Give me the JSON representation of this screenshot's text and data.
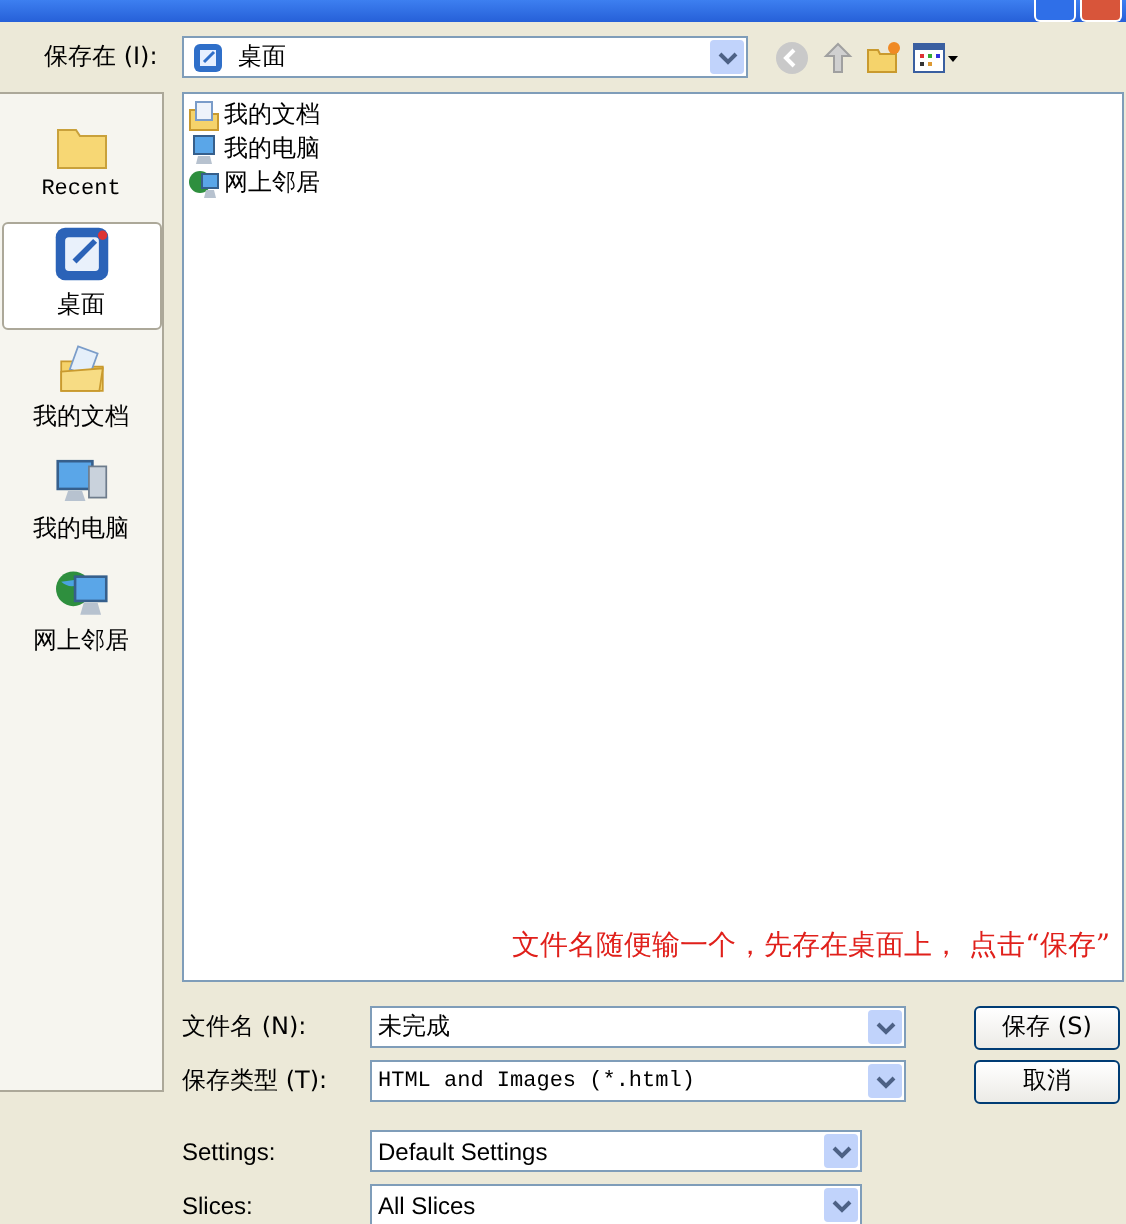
{
  "save_in": {
    "label": "保存在 (I):",
    "value": "桌面"
  },
  "places": [
    {
      "label": "Recent",
      "kind": "recent",
      "selected": false
    },
    {
      "label": "桌面",
      "kind": "desktop",
      "selected": true
    },
    {
      "label": "我的文档",
      "kind": "documents",
      "selected": false
    },
    {
      "label": "我的电脑",
      "kind": "computer",
      "selected": false
    },
    {
      "label": "网上邻居",
      "kind": "network",
      "selected": false
    }
  ],
  "files": [
    {
      "name": "我的文档",
      "kind": "documents"
    },
    {
      "name": "我的电脑",
      "kind": "computer"
    },
    {
      "name": "网上邻居",
      "kind": "network"
    }
  ],
  "annotation": "文件名随便输一个，先存在桌面上， 点击“保存”",
  "file_name": {
    "label": "文件名 (N):",
    "value": "未完成"
  },
  "file_type": {
    "label": "保存类型 (T):",
    "value": "HTML and Images (*.html)"
  },
  "settings": {
    "label": "Settings:",
    "value": "Default Settings"
  },
  "slices": {
    "label": "Slices:",
    "value": "All Slices"
  },
  "buttons": [
    "保存 (S)",
    "取消"
  ]
}
